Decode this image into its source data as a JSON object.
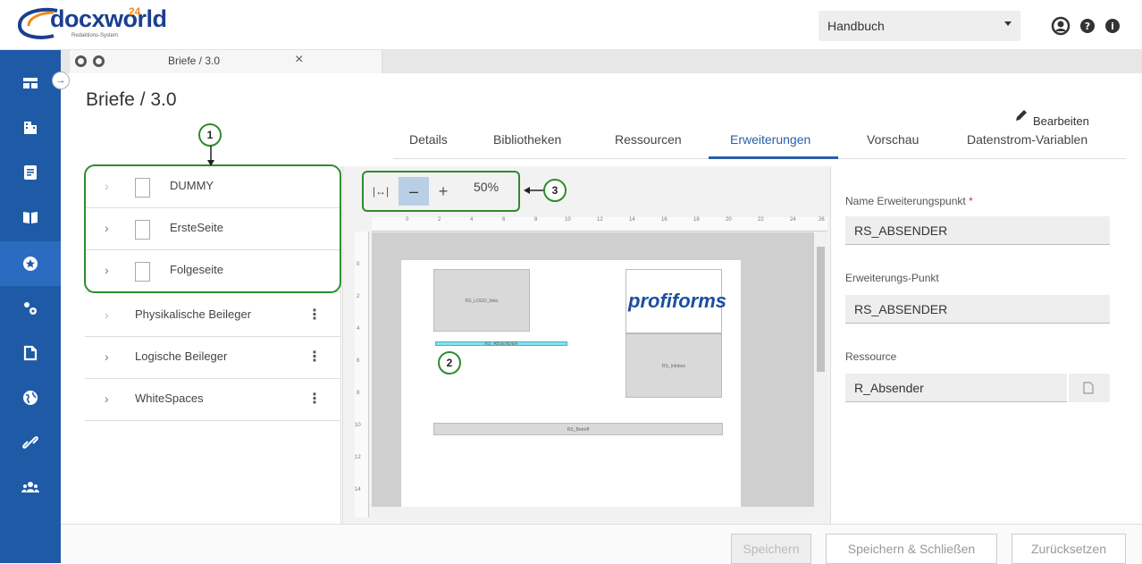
{
  "app": {
    "logo_name": "docxworld",
    "logo_sup": "24",
    "logo_sub": "Redaktions-System",
    "project": "Handbuch"
  },
  "tab": {
    "label": "Briefe / 3.0",
    "close": "×"
  },
  "page": {
    "title": "Briefe / 3.0",
    "edit_label": "Bearbeiten"
  },
  "nav_tabs": [
    "Details",
    "Bibliotheken",
    "Ressourcen",
    "Erweiterungen",
    "Vorschau",
    "Datenstrom-Variablen"
  ],
  "active_tab": "Erweiterungen",
  "tree": [
    {
      "label": "DUMMY",
      "has_box": true,
      "chev": "›"
    },
    {
      "label": "ErsteSeite",
      "has_box": true,
      "chev": "›"
    },
    {
      "label": "Folgeseite",
      "has_box": true,
      "chev": "›"
    },
    {
      "label": "Physikalische Beileger",
      "has_box": false,
      "chev": "›"
    },
    {
      "label": "Logische Beileger",
      "has_box": false,
      "chev": "›"
    },
    {
      "label": "WhiteSpaces",
      "has_box": false,
      "chev": "›"
    }
  ],
  "zoom": {
    "fit": "|↔|",
    "minus": "–",
    "plus": "+",
    "value": "50%"
  },
  "callouts": [
    "1",
    "2",
    "3"
  ],
  "preview": {
    "ruler_top": [
      "0",
      "2",
      "4",
      "6",
      "8",
      "10",
      "12",
      "14",
      "16",
      "18",
      "20",
      "22",
      "24",
      "26"
    ],
    "ruler_left": [
      "0",
      "2",
      "4",
      "6",
      "8",
      "10",
      "12",
      "14"
    ],
    "logo_box": "RS_LOGO_links",
    "brand": "profiforms",
    "absender": "RS_ABSENDER",
    "infobox": "RS_Infobox",
    "betreff": "RS_Betreff"
  },
  "form": {
    "name_label": "Name Erweiterungspunkt",
    "name_required": "*",
    "name_value": "RS_ABSENDER",
    "point_label": "Erweiterungs-Punkt",
    "point_value": "RS_ABSENDER",
    "resource_label": "Ressource",
    "resource_value": "R_Absender"
  },
  "footer": {
    "save": "Speichern",
    "save_close": "Speichern & Schließen",
    "reset": "Zurücksetzen"
  },
  "colors": {
    "sidebar": "#1f5aa6",
    "accent": "#2a5ea9",
    "callout": "#2e8b2e",
    "highlight": "#7fe3ec"
  }
}
